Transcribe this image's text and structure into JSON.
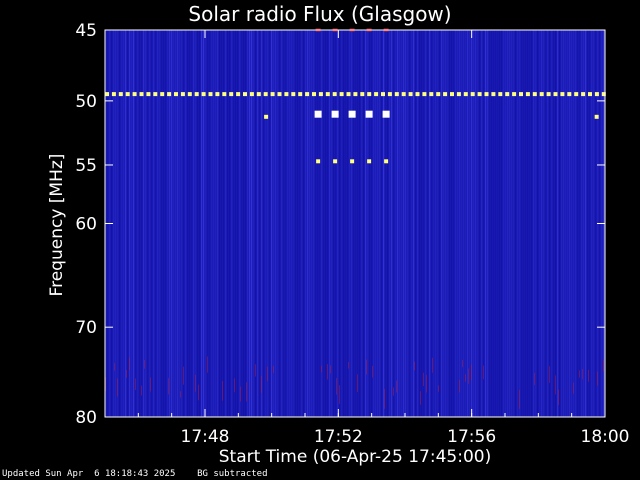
{
  "chart_data": {
    "type": "heatmap",
    "title": "Solar radio Flux (Glasgow)",
    "xlabel": "Start Time (06-Apr-25 17:45:00)",
    "ylabel": "Frequency [MHz]",
    "xlim": [
      "17:45:00",
      "18:00:00"
    ],
    "ylim": [
      45,
      80
    ],
    "y_scale": "log",
    "x_ticks": [
      "17:48",
      "17:52",
      "17:56",
      "18:00"
    ],
    "y_ticks": [
      45,
      50,
      55,
      60,
      70,
      80
    ],
    "colors": {
      "background": "#000000",
      "spectrum_base": "#1a1ab4",
      "interference": "#ffff80",
      "hot": "#ffffff",
      "noise_red": "#c02030"
    },
    "interference_lines": [
      {
        "freq_mhz": 49.5,
        "x_from": "17:45:00",
        "x_to": "18:00:00",
        "style": "dashed"
      },
      {
        "freq_mhz": 51.0,
        "x_from": "17:51:20",
        "x_to": "17:53:55",
        "style": "dashed"
      },
      {
        "freq_mhz": 54.7,
        "x_from": "17:51:20",
        "x_to": "17:53:55",
        "style": "dashed"
      },
      {
        "freq_mhz": 45.0,
        "x_from": "17:51:20",
        "x_to": "17:53:55",
        "style": "dashed"
      }
    ]
  },
  "footer": {
    "updated": "Updated Sun Apr  6 18:18:43 2025",
    "note": "BG subtracted"
  }
}
